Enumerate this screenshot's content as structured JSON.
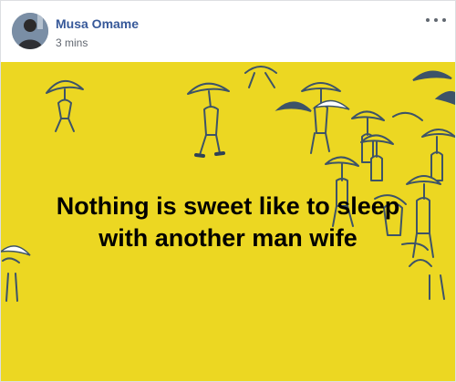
{
  "post": {
    "author_name": "Musa Omame",
    "timestamp": "3 mins",
    "menu_icon": "more-horizontal-icon",
    "caption_lines": [
      "Nothing is sweet like to sleep",
      "with another man wife"
    ],
    "background_color": "#ecd722",
    "illustration": "people-with-umbrellas-illustration"
  },
  "colors": {
    "author_link": "#365899",
    "meta_text": "#616770",
    "line_art": "#3d5368",
    "dark_umbrella": "#3d5368",
    "white_umbrella": "#ffffff"
  }
}
